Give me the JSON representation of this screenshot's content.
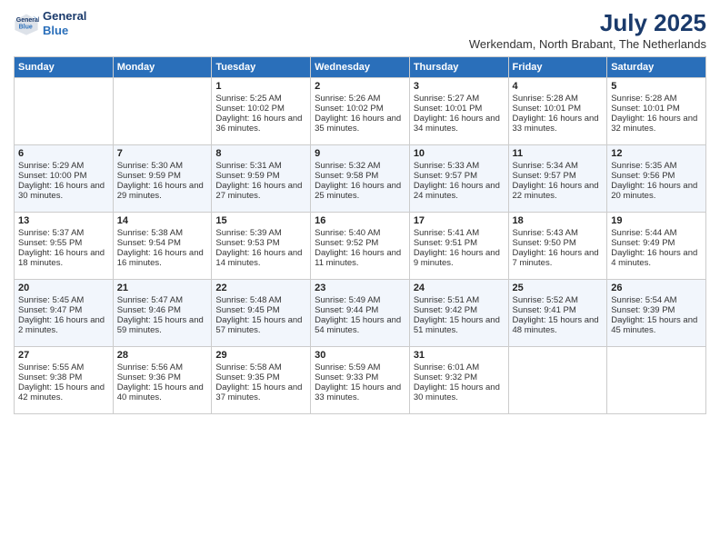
{
  "logo": {
    "line1": "General",
    "line2": "Blue"
  },
  "title": "July 2025",
  "subtitle": "Werkendam, North Brabant, The Netherlands",
  "days_header": [
    "Sunday",
    "Monday",
    "Tuesday",
    "Wednesday",
    "Thursday",
    "Friday",
    "Saturday"
  ],
  "weeks": [
    [
      {
        "day": "",
        "data": ""
      },
      {
        "day": "",
        "data": ""
      },
      {
        "day": "1",
        "data": "Sunrise: 5:25 AM\nSunset: 10:02 PM\nDaylight: 16 hours and 36 minutes."
      },
      {
        "day": "2",
        "data": "Sunrise: 5:26 AM\nSunset: 10:02 PM\nDaylight: 16 hours and 35 minutes."
      },
      {
        "day": "3",
        "data": "Sunrise: 5:27 AM\nSunset: 10:01 PM\nDaylight: 16 hours and 34 minutes."
      },
      {
        "day": "4",
        "data": "Sunrise: 5:28 AM\nSunset: 10:01 PM\nDaylight: 16 hours and 33 minutes."
      },
      {
        "day": "5",
        "data": "Sunrise: 5:28 AM\nSunset: 10:01 PM\nDaylight: 16 hours and 32 minutes."
      }
    ],
    [
      {
        "day": "6",
        "data": "Sunrise: 5:29 AM\nSunset: 10:00 PM\nDaylight: 16 hours and 30 minutes."
      },
      {
        "day": "7",
        "data": "Sunrise: 5:30 AM\nSunset: 9:59 PM\nDaylight: 16 hours and 29 minutes."
      },
      {
        "day": "8",
        "data": "Sunrise: 5:31 AM\nSunset: 9:59 PM\nDaylight: 16 hours and 27 minutes."
      },
      {
        "day": "9",
        "data": "Sunrise: 5:32 AM\nSunset: 9:58 PM\nDaylight: 16 hours and 25 minutes."
      },
      {
        "day": "10",
        "data": "Sunrise: 5:33 AM\nSunset: 9:57 PM\nDaylight: 16 hours and 24 minutes."
      },
      {
        "day": "11",
        "data": "Sunrise: 5:34 AM\nSunset: 9:57 PM\nDaylight: 16 hours and 22 minutes."
      },
      {
        "day": "12",
        "data": "Sunrise: 5:35 AM\nSunset: 9:56 PM\nDaylight: 16 hours and 20 minutes."
      }
    ],
    [
      {
        "day": "13",
        "data": "Sunrise: 5:37 AM\nSunset: 9:55 PM\nDaylight: 16 hours and 18 minutes."
      },
      {
        "day": "14",
        "data": "Sunrise: 5:38 AM\nSunset: 9:54 PM\nDaylight: 16 hours and 16 minutes."
      },
      {
        "day": "15",
        "data": "Sunrise: 5:39 AM\nSunset: 9:53 PM\nDaylight: 16 hours and 14 minutes."
      },
      {
        "day": "16",
        "data": "Sunrise: 5:40 AM\nSunset: 9:52 PM\nDaylight: 16 hours and 11 minutes."
      },
      {
        "day": "17",
        "data": "Sunrise: 5:41 AM\nSunset: 9:51 PM\nDaylight: 16 hours and 9 minutes."
      },
      {
        "day": "18",
        "data": "Sunrise: 5:43 AM\nSunset: 9:50 PM\nDaylight: 16 hours and 7 minutes."
      },
      {
        "day": "19",
        "data": "Sunrise: 5:44 AM\nSunset: 9:49 PM\nDaylight: 16 hours and 4 minutes."
      }
    ],
    [
      {
        "day": "20",
        "data": "Sunrise: 5:45 AM\nSunset: 9:47 PM\nDaylight: 16 hours and 2 minutes."
      },
      {
        "day": "21",
        "data": "Sunrise: 5:47 AM\nSunset: 9:46 PM\nDaylight: 15 hours and 59 minutes."
      },
      {
        "day": "22",
        "data": "Sunrise: 5:48 AM\nSunset: 9:45 PM\nDaylight: 15 hours and 57 minutes."
      },
      {
        "day": "23",
        "data": "Sunrise: 5:49 AM\nSunset: 9:44 PM\nDaylight: 15 hours and 54 minutes."
      },
      {
        "day": "24",
        "data": "Sunrise: 5:51 AM\nSunset: 9:42 PM\nDaylight: 15 hours and 51 minutes."
      },
      {
        "day": "25",
        "data": "Sunrise: 5:52 AM\nSunset: 9:41 PM\nDaylight: 15 hours and 48 minutes."
      },
      {
        "day": "26",
        "data": "Sunrise: 5:54 AM\nSunset: 9:39 PM\nDaylight: 15 hours and 45 minutes."
      }
    ],
    [
      {
        "day": "27",
        "data": "Sunrise: 5:55 AM\nSunset: 9:38 PM\nDaylight: 15 hours and 42 minutes."
      },
      {
        "day": "28",
        "data": "Sunrise: 5:56 AM\nSunset: 9:36 PM\nDaylight: 15 hours and 40 minutes."
      },
      {
        "day": "29",
        "data": "Sunrise: 5:58 AM\nSunset: 9:35 PM\nDaylight: 15 hours and 37 minutes."
      },
      {
        "day": "30",
        "data": "Sunrise: 5:59 AM\nSunset: 9:33 PM\nDaylight: 15 hours and 33 minutes."
      },
      {
        "day": "31",
        "data": "Sunrise: 6:01 AM\nSunset: 9:32 PM\nDaylight: 15 hours and 30 minutes."
      },
      {
        "day": "",
        "data": ""
      },
      {
        "day": "",
        "data": ""
      }
    ]
  ]
}
